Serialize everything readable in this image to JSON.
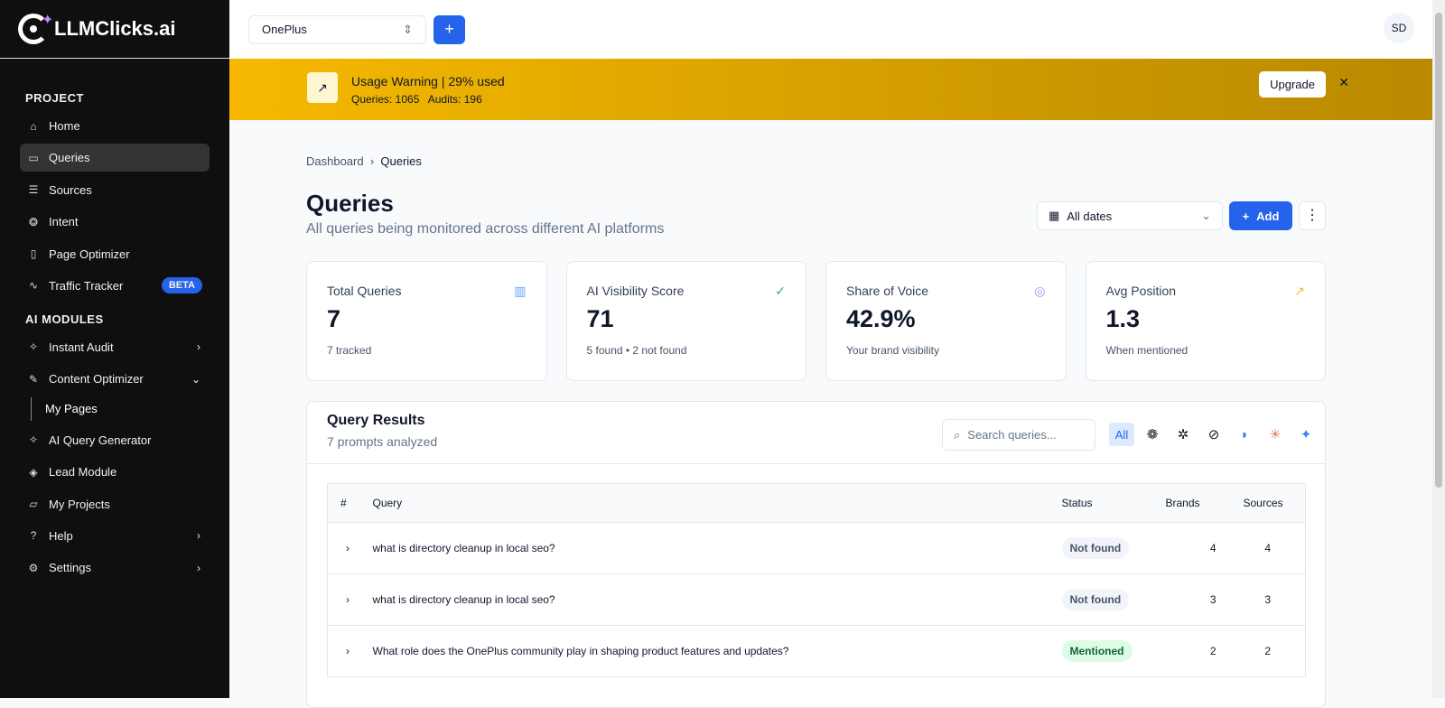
{
  "brand": "LLMClicks.ai",
  "sidebar": {
    "project_label": "PROJECT",
    "modules_label": "AI MODULES",
    "project": [
      {
        "label": "Home",
        "icon": "home"
      },
      {
        "label": "Queries",
        "icon": "message"
      },
      {
        "label": "Sources",
        "icon": "database"
      },
      {
        "label": "Intent",
        "icon": "brain"
      },
      {
        "label": "Page Optimizer",
        "icon": "file"
      },
      {
        "label": "Traffic Tracker",
        "icon": "activity",
        "badge": "BETA"
      }
    ],
    "modules": [
      {
        "label": "Instant Audit"
      },
      {
        "label": "Content Optimizer"
      },
      {
        "label": "My Pages"
      },
      {
        "label": "AI Query Generator"
      },
      {
        "label": "Lead Module"
      },
      {
        "label": "My Projects"
      },
      {
        "label": "Help"
      },
      {
        "label": "Settings"
      }
    ]
  },
  "topbar": {
    "project": "OnePlus",
    "avatar": "SD"
  },
  "warning": {
    "title": "Usage Warning | 29% used",
    "details": "Queries: 1065   Audits: 196",
    "upgrade": "Upgrade",
    "used_percent": 29
  },
  "breadcrumb": [
    "Dashboard",
    "Queries"
  ],
  "page": {
    "title": "Queries",
    "subtitle": "All queries being monitored across different AI platforms",
    "dates": "All dates",
    "add": "Add"
  },
  "cards": [
    {
      "title": "Total Queries",
      "value": "7",
      "sub": "7 tracked"
    },
    {
      "title": "AI Visibility Score",
      "value": "71",
      "sub": "5 found • 2 not found"
    },
    {
      "title": "Share of Voice",
      "value": "42.9%",
      "sub": "Your brand visibility"
    },
    {
      "title": "Avg Position",
      "value": "1.3",
      "sub": "When mentioned"
    }
  ],
  "results": {
    "title": "Query Results",
    "subtitle": "7 prompts analyzed",
    "search_placeholder": "Search queries...",
    "filter_all": "All",
    "platforms": [
      "chatgpt",
      "perplexity",
      "grok",
      "deepseek",
      "claude",
      "gemini"
    ],
    "headers": [
      "#",
      "Query",
      "Status",
      "Brands",
      "Sources"
    ],
    "rows": [
      {
        "query": "what is directory cleanup in local seo?",
        "status": "Not found",
        "brands": "4",
        "sources": "4"
      },
      {
        "query": "what is directory cleanup in local seo?",
        "status": "Not found",
        "brands": "3",
        "sources": "3"
      },
      {
        "query": "What role does the OnePlus community play in shaping product features and updates?",
        "status": "Mentioned",
        "brands": "2",
        "sources": "2"
      }
    ]
  }
}
